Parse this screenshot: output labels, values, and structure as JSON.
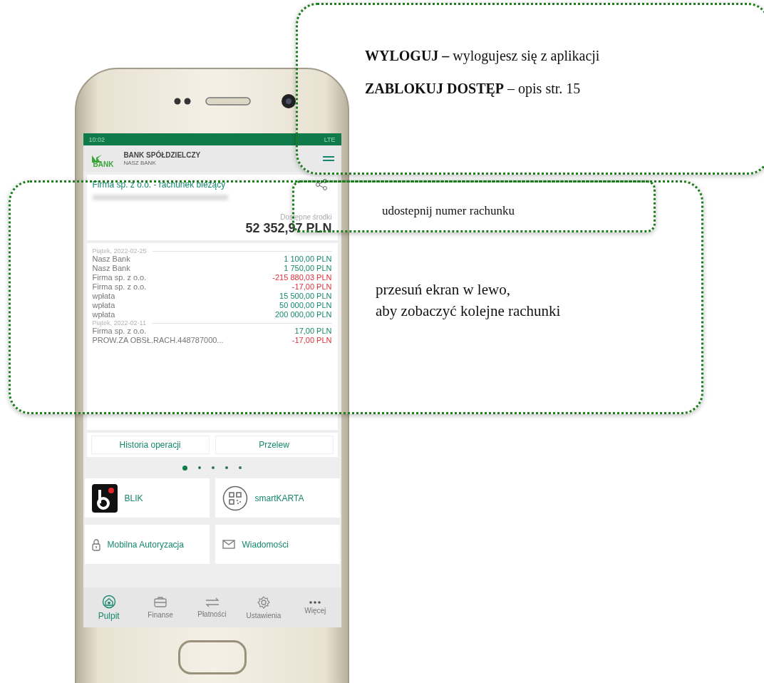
{
  "phone": {
    "status_bar": {
      "time": "10:02",
      "network": "LTE"
    },
    "header": {
      "logo_text": "BANK",
      "bank_name": "BANK SPÓŁDZIELCZY",
      "bank_subtitle": "NASZ BANK"
    },
    "account": {
      "name": "Firma sp. z o.o. - rachunek bieżący",
      "balance_label": "Dostępne środki",
      "balance": "52 352,97 PLN"
    },
    "transaction_groups": [
      {
        "date": "Piątek, 2022-02-25",
        "rows": [
          {
            "name": "Nasz Bank",
            "amount": "1 100,00 PLN",
            "kind": "credit"
          },
          {
            "name": "Nasz Bank",
            "amount": "1 750,00 PLN",
            "kind": "credit"
          },
          {
            "name": "Firma sp. z o.o.",
            "amount": "-215 880,03 PLN",
            "kind": "debit"
          },
          {
            "name": "Firma sp. z o.o.",
            "amount": "-17,00 PLN",
            "kind": "debit"
          },
          {
            "name": "wpłata",
            "amount": "15 500,00 PLN",
            "kind": "credit"
          },
          {
            "name": "wpłata",
            "amount": "50 000,00 PLN",
            "kind": "credit"
          },
          {
            "name": "wpłata",
            "amount": "200 000,00 PLN",
            "kind": "credit"
          }
        ]
      },
      {
        "date": "Piątek, 2022-02-11",
        "rows": [
          {
            "name": "Firma sp. z o.o.",
            "amount": "17,00 PLN",
            "kind": "credit"
          },
          {
            "name": "PROW.ZA OBSŁ.RACH.448787000...",
            "amount": "-17,00 PLN",
            "kind": "debit"
          }
        ]
      }
    ],
    "action_buttons": [
      "Historia operacji",
      "Przelew"
    ],
    "page_dots": [
      {
        "selected": true
      },
      {
        "selected": false
      },
      {
        "selected": false
      },
      {
        "selected": false
      },
      {
        "selected": false
      }
    ],
    "tiles": [
      {
        "label": "BLIK",
        "kind": "blik"
      },
      {
        "label": "smartKARTA",
        "kind": "qr"
      },
      {
        "label": "Mobilna Autoryzacja",
        "kind": "lock"
      },
      {
        "label": "Wiadomości",
        "kind": "mail"
      }
    ],
    "bottom_nav": [
      {
        "label": "Pulpit",
        "kind": "home",
        "selected": true
      },
      {
        "label": "Finanse",
        "kind": "wallet",
        "selected": false
      },
      {
        "label": "Płatności",
        "kind": "transfer",
        "selected": false
      },
      {
        "label": "Ustawienia",
        "kind": "gear",
        "selected": false
      },
      {
        "label": "Więcej",
        "kind": "more",
        "selected": false
      }
    ]
  },
  "callouts": [
    {
      "kind": "menu",
      "lines": [
        "**WYLOGUJ –** wylogujesz się z aplikacji",
        "**ZABLOKUJ DOSTĘP** – opis str. 15"
      ]
    },
    {
      "kind": "share",
      "lines": [
        "udostepnij numer rachunku"
      ]
    },
    {
      "kind": "accounts",
      "lines": [
        "przesuń ekran w lewo,",
        "aby zobaczyć kolejne rachunki"
      ]
    }
  ]
}
